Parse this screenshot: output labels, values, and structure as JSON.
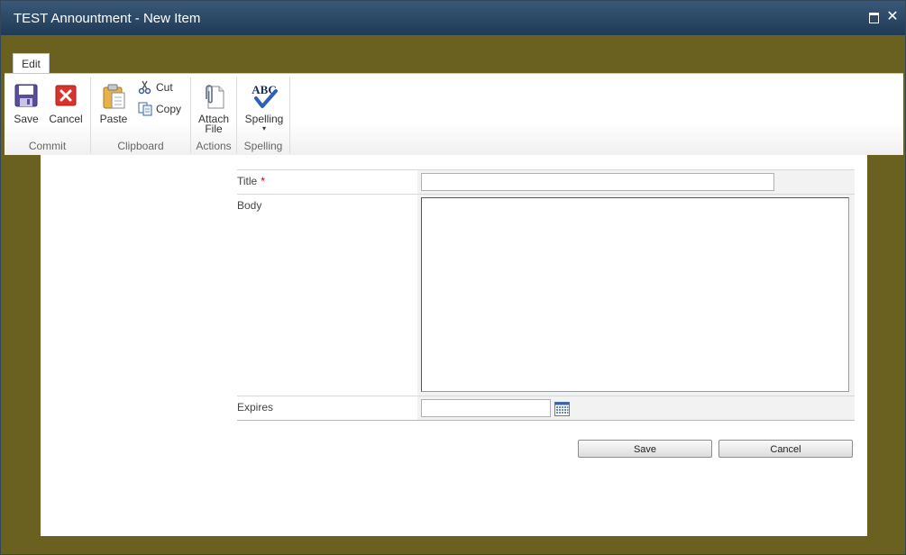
{
  "window": {
    "title": "TEST Annountment - New Item"
  },
  "ribbon": {
    "tab": "Edit",
    "groups": {
      "commit": {
        "label": "Commit",
        "save": "Save",
        "cancel": "Cancel"
      },
      "clipboard": {
        "label": "Clipboard",
        "paste": "Paste",
        "cut": "Cut",
        "copy": "Copy"
      },
      "actions": {
        "label": "Actions",
        "attach_line1": "Attach",
        "attach_line2": "File"
      },
      "spelling": {
        "label": "Spelling",
        "spelling": "Spelling",
        "abc": "ABC"
      }
    }
  },
  "form": {
    "fields": {
      "title": {
        "label": "Title",
        "required_mark": "*",
        "value": ""
      },
      "body": {
        "label": "Body",
        "value": ""
      },
      "expires": {
        "label": "Expires",
        "value": ""
      }
    },
    "buttons": {
      "save": "Save",
      "cancel": "Cancel"
    }
  },
  "colors": {
    "titlebar": "#1f3a56",
    "page_background": "#6a6020",
    "required": "#bf0000"
  }
}
